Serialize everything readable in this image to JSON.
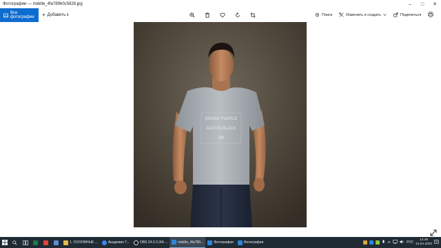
{
  "window": {
    "title": "Фотографии — middle_4fa789b0c5828.jpg"
  },
  "toolbar": {
    "all_photos": "Все фотографии",
    "add_to": "Добавить к",
    "search": "Поиск",
    "edit_create": "Изменить и создать",
    "share": "Поделиться"
  },
  "taskbar": {
    "apps": [
      {
        "label": "1. ОСНОВНЫЕ ...",
        "color": "#e7b84a"
      },
      {
        "label": "Академия Т...",
        "color": "#4285f4"
      },
      {
        "label": "OBS 24.0.3 (64-...",
        "color": "#ffffff"
      },
      {
        "label": "middle_4fa789...",
        "color": "#2b88d8"
      },
      {
        "label": "Фотографии",
        "color": "#2b88d8"
      },
      {
        "label": "Фотографии",
        "color": "#2b88d8"
      }
    ],
    "language": "РУС",
    "time": "12:49",
    "date": "12.04.2020"
  },
  "photo": {
    "shirt_text": [
      "GRAND PURPLE",
      "AUSTIN BLACK",
      "08"
    ]
  },
  "colors": {
    "accent": "#0f6ccf",
    "taskbar": "#1f2a33"
  }
}
